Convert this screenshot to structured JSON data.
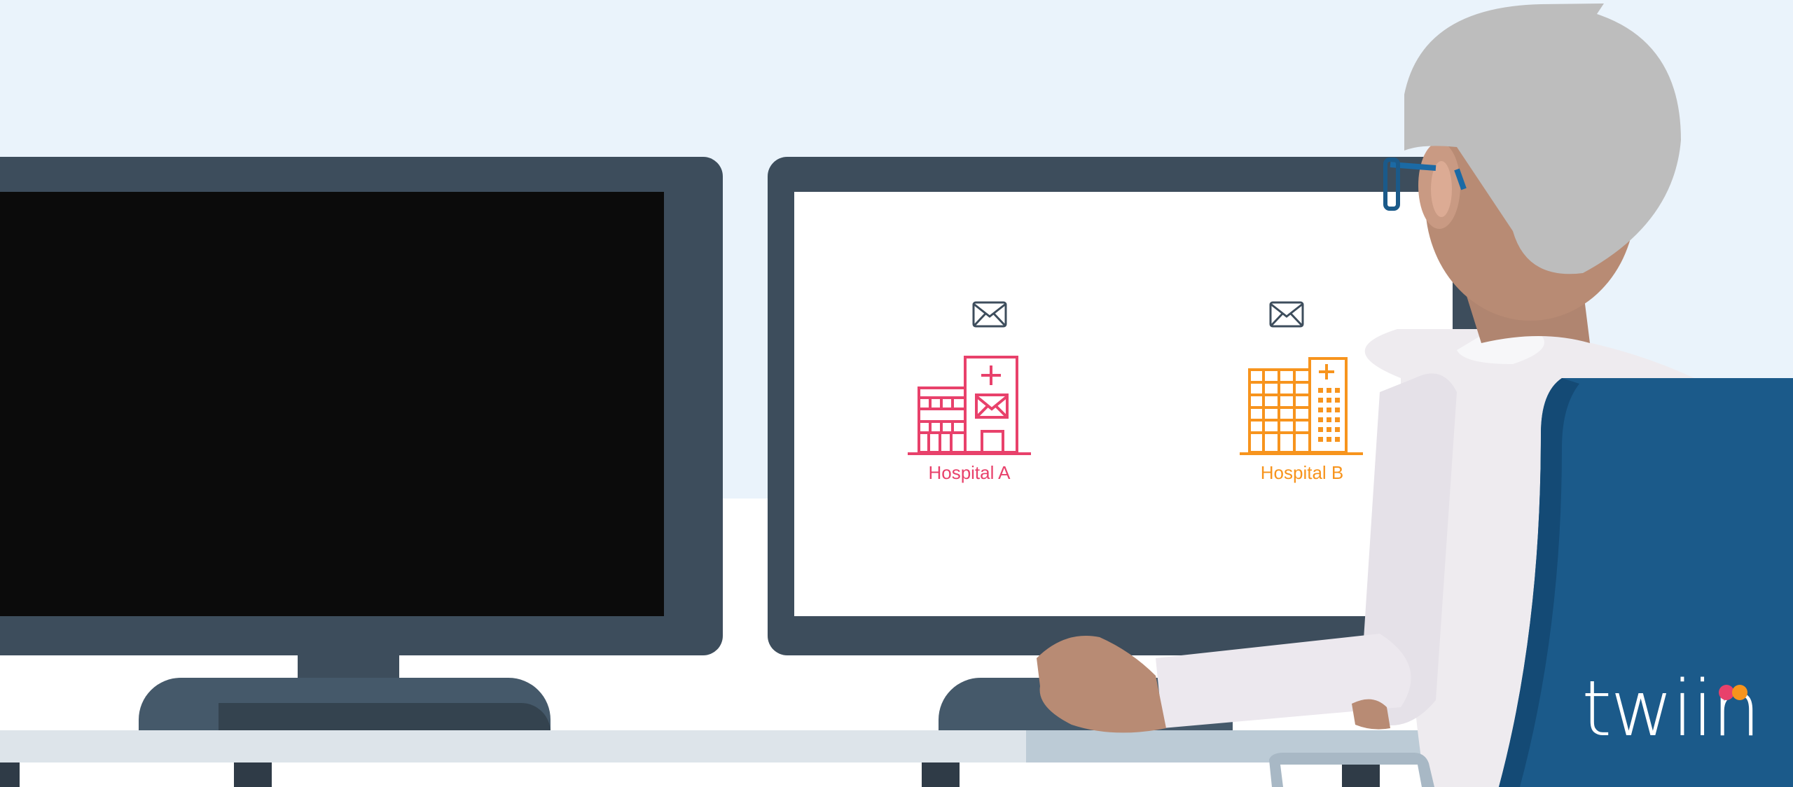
{
  "hospitals": [
    {
      "label": "Hospital A",
      "color": "#e8416b"
    },
    {
      "label": "Hospital B",
      "color": "#f7941d"
    }
  ],
  "logo": {
    "text": "twiin"
  },
  "icons": {
    "mail_a": "envelope-icon",
    "mail_b": "envelope-icon",
    "hospital_a": "hospital-building-icon",
    "hospital_b": "hospital-building-icon"
  },
  "colors": {
    "monitor_frame": "#3d4d5c",
    "chair": "#1b5a8a",
    "wall": "#eaf3fb"
  }
}
